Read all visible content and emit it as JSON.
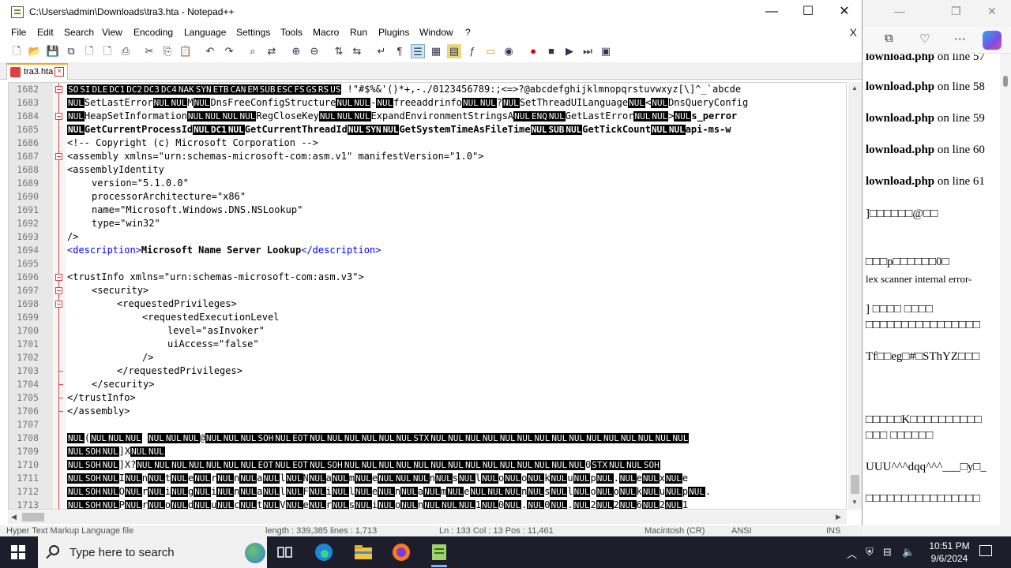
{
  "window": {
    "title": "C:\\Users\\admin\\Downloads\\tra3.hta - Notepad++",
    "minimize": "—",
    "maximize": "☐",
    "close": "✕"
  },
  "menu": [
    "File",
    "Edit",
    "Search",
    "View",
    "Encoding",
    "Language",
    "Settings",
    "Tools",
    "Macro",
    "Run",
    "Plugins",
    "Window",
    "?"
  ],
  "menu_close": "X",
  "tab": {
    "label": "tra3.hta",
    "close": "×"
  },
  "editor": {
    "line_numbers": [
      "1682",
      "1683",
      "1684",
      "1685",
      "1686",
      "1687",
      "1688",
      "1689",
      "1690",
      "1691",
      "1692",
      "1693",
      "1694",
      "1695",
      "1696",
      "1697",
      "1698",
      "1699",
      "1700",
      "1701",
      "1702",
      "1703",
      "1704",
      "1705",
      "1706",
      "1707",
      "1708",
      "1709",
      "1710",
      "1711",
      "1712",
      "1713"
    ],
    "comment": "<!-- Copyright (c) Microsoft Corporation -->",
    "assembly_open": "<assembly xmlns=\"urn:schemas-microsoft-com:asm.v1\" manifestVersion=\"1.0\">",
    "assembly_identity": "<assemblyIdentity",
    "version": "version=\"5.1.0.0\"",
    "processor": "processorArchitecture=\"x86\"",
    "name": "name=\"Microsoft.Windows.DNS.NSLookup\"",
    "type": "type=\"win32\"",
    "self_close": "/>",
    "description_open": "<description>",
    "description_text": "Microsoft Name Server Lookup",
    "description_close": "</description>",
    "trust_open": "<trustInfo xmlns=\"urn:schemas-microsoft-com:asm.v3\">",
    "security_open": "<security>",
    "req_priv_open": "<requestedPrivileges>",
    "req_exec": "<requestedExecutionLevel",
    "level": "level=\"asInvoker\"",
    "ui_access": "uiAccess=\"false\"",
    "exec_close": "/>",
    "req_priv_close": "</requestedPrivileges>",
    "security_close": "</security>",
    "trust_close": "</trustInfo>",
    "assembly_close": "</assembly>",
    "l1682_text": " !\"#$%&'()*+,-./0123456789:;<=>?@abcdefghijklmnopqrstuvwxyz[\\]^_`abcde",
    "l1683_a": "SetLastError",
    "l1683_b": "DnsFreeConfigStructure",
    "l1683_c": "freeaddrinfo",
    "l1683_d": "SetThreadUILanguage",
    "l1683_e": "DnsQueryConfig",
    "l1684_a": "HeapSetInformation",
    "l1684_b": "RegCloseKey",
    "l1684_c": "ExpandEnvironmentStringsA",
    "l1684_d": "GetLastError",
    "l1684_e": "s_perror",
    "l1685_a": "GetCurrentProcessId",
    "l1685_b": "GetCurrentThreadId",
    "l1685_c": "GetSystemTimeAsFileTime",
    "l1685_d": "GetTickCount",
    "l1685_e": "api-ms-w"
  },
  "status": {
    "type": "Hyper Text Markup Language file",
    "length": "length : 339,385    lines : 1,713",
    "position": "Ln : 133    Col : 13    Pos : 11,461",
    "eol": "Macintosh (CR)",
    "encoding": "ANSI",
    "mode": "INS"
  },
  "browser": {
    "lines": [
      {
        "bold": "lownload.php",
        "rest": " on line 57"
      },
      {
        "bold": "lownload.php",
        "rest": " on line 58"
      },
      {
        "bold": "lownload.php",
        "rest": " on line 59"
      },
      {
        "bold": "lownload.php",
        "rest": " on line 60"
      },
      {
        "bold": "lownload.php",
        "rest": " on line 61"
      }
    ],
    "garbage1": "]□□□□□□@□□",
    "garbage2": "□□□p□□□□□□0□",
    "error": "lex scanner internal error-",
    "garbage3": "] □□□□ □□□□",
    "garbage4": "□□□□□□□□□□□□□□□□",
    "garbage5": "Tf□□eg□#□SThYZ□□□",
    "garbage6": "□□□□□K□□□□□□□□□□",
    "garbage7": "□□□ □□□□□□",
    "garbage8": "UUU^^^dqq^^^___□y□_",
    "garbage9": "□□□□□□□□□□□□□□□□"
  },
  "taskbar": {
    "search_placeholder": "Type here to search",
    "time": "10:51 PM",
    "date": "9/6/2024"
  },
  "colors": {
    "accent_tab": "#f5a623",
    "fold_marker": "#e04040",
    "xml_tag": "#0000ff",
    "xml_attr": "#ff0000",
    "xml_value": "#8000ff",
    "comment": "#008000"
  }
}
